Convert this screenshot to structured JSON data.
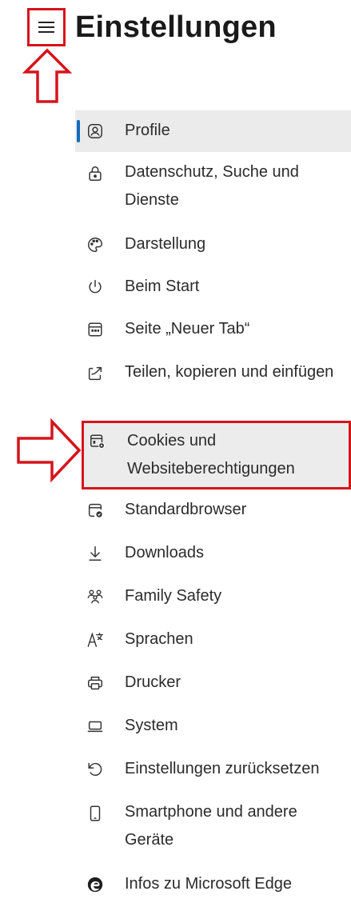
{
  "header": {
    "title": "Einstellungen",
    "menu_icon": "hamburger-menu-icon"
  },
  "annotations": {
    "color": "#d6141c"
  },
  "nav": {
    "active_color": "#0f6cbd",
    "items": [
      {
        "label": "Profile",
        "icon": "profile-icon",
        "active": true
      },
      {
        "label": "Datenschutz, Suche und Dienste",
        "icon": "lock-icon"
      },
      {
        "label": "Darstellung",
        "icon": "palette-icon"
      },
      {
        "label": "Beim Start",
        "icon": "power-icon"
      },
      {
        "label": "Seite „Neuer Tab“",
        "icon": "new-tab-icon"
      },
      {
        "label": "Teilen, kopieren und einfügen",
        "icon": "share-icon"
      },
      {
        "label": "Cookies und Websiteberechtigungen",
        "icon": "cookies-permissions-icon",
        "highlighted": true
      },
      {
        "label": "Standardbrowser",
        "icon": "default-browser-icon"
      },
      {
        "label": "Downloads",
        "icon": "download-icon"
      },
      {
        "label": "Family Safety",
        "icon": "family-icon"
      },
      {
        "label": "Sprachen",
        "icon": "language-icon"
      },
      {
        "label": "Drucker",
        "icon": "printer-icon"
      },
      {
        "label": "System",
        "icon": "laptop-icon"
      },
      {
        "label": "Einstellungen zurücksetzen",
        "icon": "reset-icon"
      },
      {
        "label": "Smartphone und andere Geräte",
        "icon": "smartphone-icon"
      },
      {
        "label": "Infos zu Microsoft Edge",
        "icon": "edge-logo-icon"
      }
    ]
  }
}
